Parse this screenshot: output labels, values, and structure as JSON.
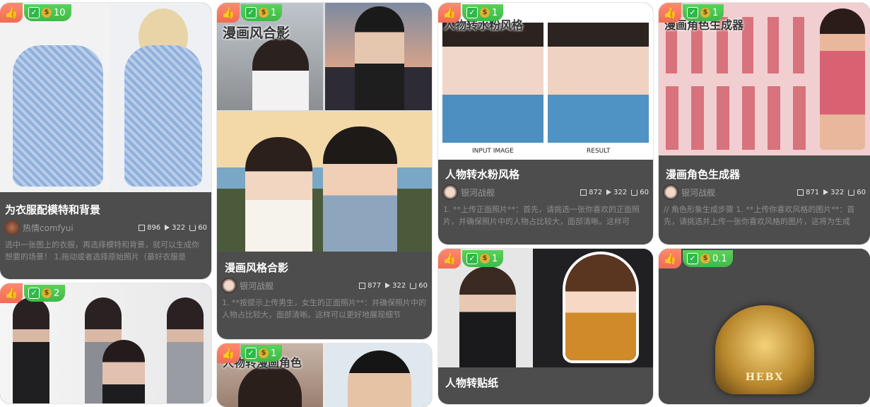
{
  "cards": [
    {
      "title": "为衣服配模特和背景",
      "author": "热情comfyui",
      "price": "10",
      "stats": {
        "views": "896",
        "plays": "322",
        "downloads": "60"
      },
      "desc": "选中一张图上的衣服，再选择模特和背景，就可以生成你想要的场景！ 1,拖动或者选择原始照片（最好衣服是"
    },
    {
      "title": "漫画风格合影",
      "author": "银河战舰",
      "price": "1",
      "stats": {
        "views": "877",
        "plays": "322",
        "downloads": "60"
      },
      "desc": "1. **按提示上传男生，女生的正面照片**：并确保照片中的人物占比较大，面部清晰。这样可以更好地展现细节",
      "overlay": "漫画风合影"
    },
    {
      "title": "人物转水粉风格",
      "author": "银河战舰",
      "price": "1",
      "stats": {
        "views": "872",
        "plays": "322",
        "downloads": "60"
      },
      "desc": "1. **上传正面照片**：首先，请挑选一张你喜欢的正面照片，并确保照片中的人物占比较大，面部清晰。这样可",
      "overlay": "人物转水粉风格",
      "label_input": "INPUT IMAGE",
      "label_result": "RESULT"
    },
    {
      "title": "漫画角色生成器",
      "author": "银河战舰",
      "price": "1",
      "stats": {
        "views": "871",
        "plays": "322",
        "downloads": "60"
      },
      "desc": "// 角色形象生成步骤 1. **上传你喜欢风格的图片**：首先，请挑选并上传一张你喜欢风格的图片，这将为生成",
      "overlay": "漫画角色生成器"
    },
    {
      "price": "2"
    },
    {
      "price": "1",
      "overlay": "人物转漫画角色"
    },
    {
      "title": "人物转贴纸",
      "price": "1"
    },
    {
      "price": "0.1",
      "logo_text": "HEBX"
    }
  ],
  "icons": {
    "hot": "thumbs-up-icon",
    "check": "check-icon",
    "coin": "money-bag-icon"
  }
}
